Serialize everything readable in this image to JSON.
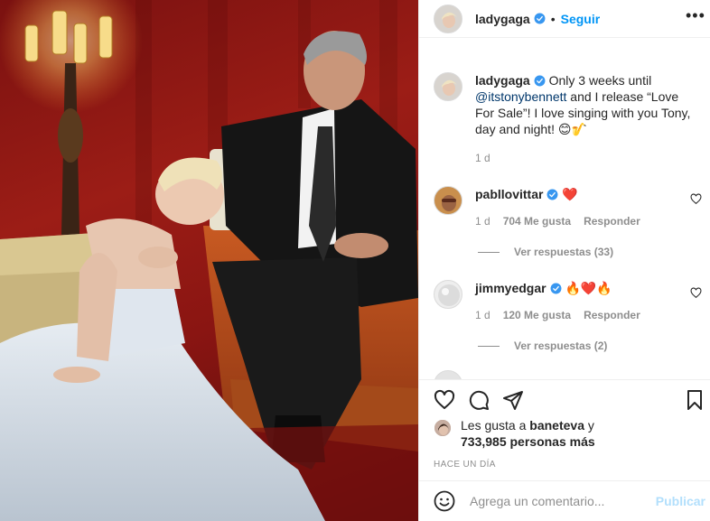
{
  "post": {
    "username": "ladygaga",
    "follow_label": "Seguir",
    "separator": "•",
    "more_label": "•••"
  },
  "caption": {
    "username": "ladygaga",
    "text_before": "Only 3 weeks until",
    "mention": "@itstonybennett",
    "text_after": "and I release “Love For Sale”! I love singing with you Tony, day and night! 😊🎷",
    "age": "1 d"
  },
  "comments": [
    {
      "username": "pabllovittar",
      "text": "❤️",
      "age": "1 d",
      "likes": "704 Me gusta",
      "reply_label": "Responder",
      "replies_label": "Ver respuestas (33)"
    },
    {
      "username": "jimmyedgar",
      "text": "🔥❤️🔥",
      "age": "1 d",
      "likes": "120 Me gusta",
      "reply_label": "Responder",
      "replies_label": "Ver respuestas (2)"
    }
  ],
  "likes": {
    "prefix": "Les gusta a",
    "user": "baneteva",
    "joiner": "y",
    "count": "733,985 personas más"
  },
  "time_ago": "HACE UN DÍA",
  "add_comment": {
    "placeholder": "Agrega un comentario...",
    "publish_label": "Publicar"
  },
  "colors": {
    "accent": "#0095f6",
    "verified": "#3897f0",
    "heart": "#ed4956",
    "publish_disabled": "#b2dffc"
  }
}
